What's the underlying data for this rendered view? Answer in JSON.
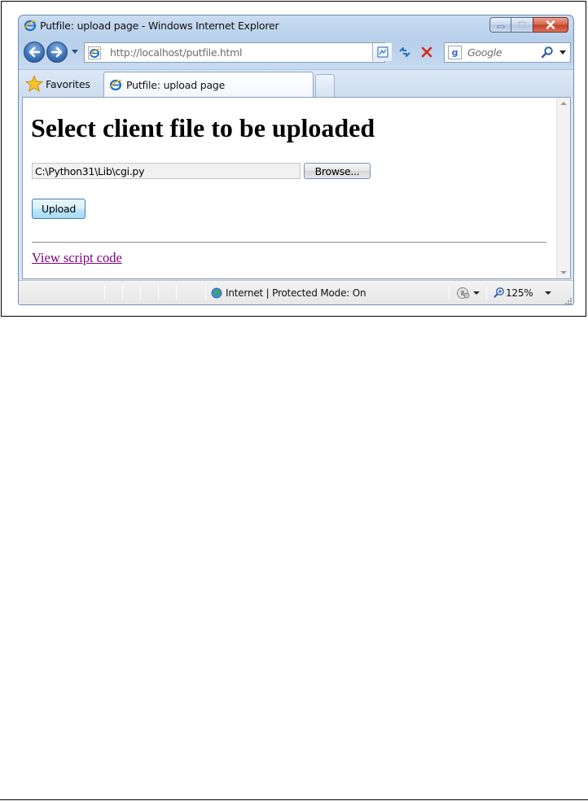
{
  "window": {
    "title": "Putfile: upload page - Windows Internet Explorer"
  },
  "navigation": {
    "address": "http://localhost/putfile.html",
    "search_placeholder": "Google",
    "search_provider_icon": "google-icon"
  },
  "favorites": {
    "label": "Favorites"
  },
  "tabs": [
    {
      "label": "Putfile: upload page",
      "active": true
    }
  ],
  "page": {
    "heading": "Select client file to be uploaded",
    "file_input_value": "C:\\Python31\\Lib\\cgi.py",
    "browse_label": "Browse...",
    "upload_label": "Upload",
    "link_text": "View script code"
  },
  "status_bar": {
    "zone": "Internet | Protected Mode: On",
    "zoom": "125%"
  },
  "colors": {
    "link_visited": "#800080",
    "close_button": "#c2432a",
    "chrome_blue": "#b8cfea"
  }
}
